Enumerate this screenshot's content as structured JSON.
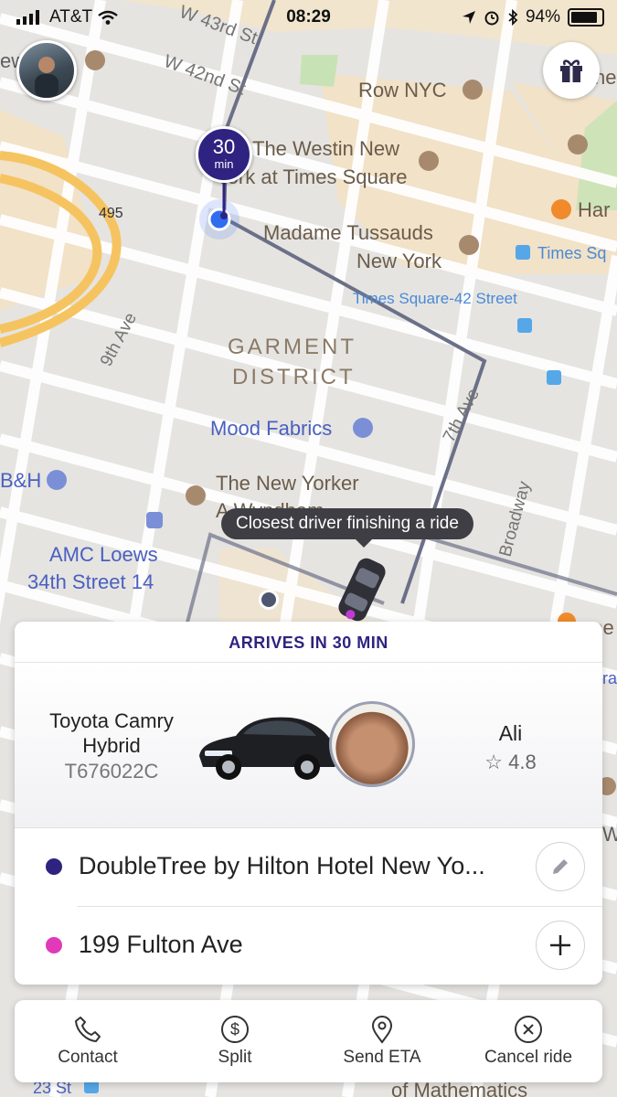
{
  "status_bar": {
    "carrier": "AT&T",
    "time": "08:29",
    "battery": "94%"
  },
  "map": {
    "labels": {
      "w43": "W 43rd St",
      "w42": "W 42nd St",
      "row_nyc": "Row NYC",
      "westin1": "The Westin New",
      "westin2": "York at Times Square",
      "hw495": "495",
      "tussauds1": "Madame Tussauds",
      "tussauds2": "New York",
      "times_sq": "Times Sq",
      "times42": "Times Square-42 Street",
      "har": "Har",
      "ninth_ave": "9th Ave",
      "garment1": "GARMENT",
      "garment2": "DISTRICT",
      "seventh_ave": "7th Ave",
      "mood": "Mood Fabrics",
      "bh": "B&H",
      "new_yorker1": "The New Yorker",
      "new_yorker2": "A Wyndham",
      "broadway": "Broadway",
      "amc1": "AMC Loews",
      "amc2": "34th Street 14",
      "st23": "23 St",
      "math": "of Mathematics",
      "edge_ew": "ew",
      "edge_he": "he",
      "edge_ree": "ree",
      "edge_ra": "ra",
      "edge_w": "W"
    }
  },
  "eta_pin": {
    "number": "30",
    "unit": "min"
  },
  "tooltip": "Closest driver finishing a ride",
  "ride_card": {
    "arrives": "ARRIVES IN 30 MIN",
    "car_line1": "Toyota Camry",
    "car_line2": "Hybrid",
    "plate": "T676022C",
    "driver_name": "Ali",
    "rating": "4.8",
    "rating_star": "☆",
    "pickup": "DoubleTree by Hilton Hotel New Yo...",
    "dropoff": "199 Fulton Ave"
  },
  "actions": {
    "contact": "Contact",
    "split": "Split",
    "send_eta": "Send ETA",
    "cancel": "Cancel ride",
    "split_symbol": "$"
  },
  "colors": {
    "accent": "#2e2380",
    "pickup_dot": "#2e2380",
    "dropoff_dot": "#e03ab8",
    "route": "#6b7088",
    "major_road": "#f6c66a",
    "map_bg": "#e8e6e2"
  }
}
